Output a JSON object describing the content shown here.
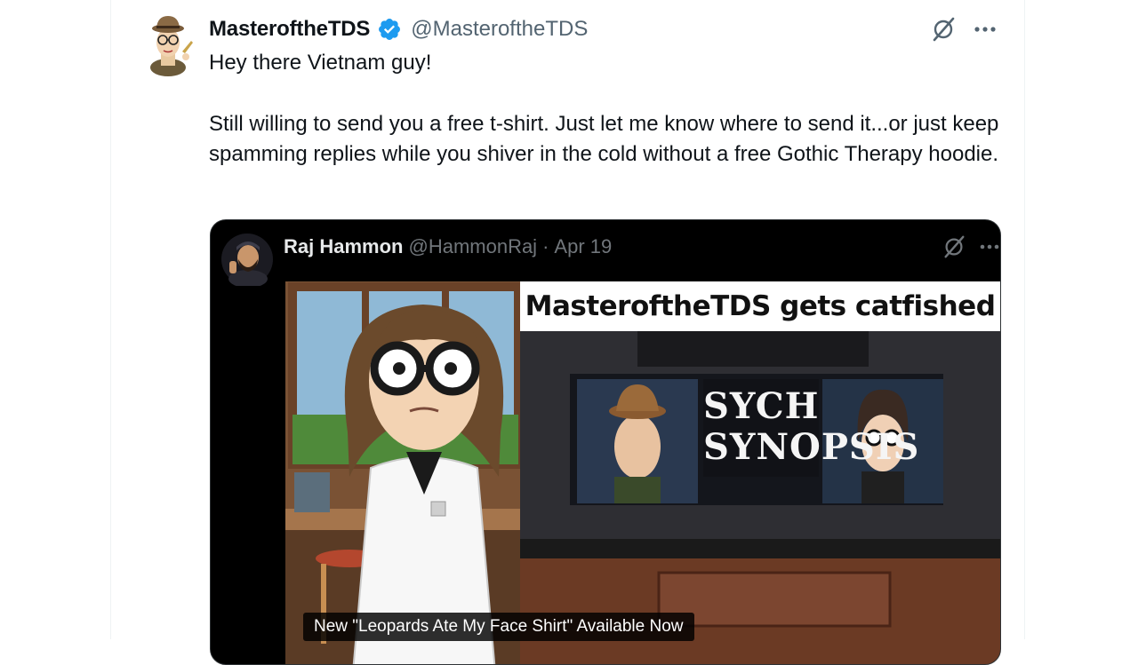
{
  "tweet": {
    "author_name": "MasteroftheTDS",
    "author_handle": "@MasteroftheTDS",
    "verified": true,
    "avatar_icon": "cartoon-man-with-hat-avatar",
    "actions": {
      "grok_icon": "grok-icon",
      "more_icon": "more-dots-icon"
    },
    "text_lines": [
      "Hey there Vietnam guy!",
      "Still willing to send you a free t-shirt. Just let me know where to send it...or just keep spamming replies while you shiver in the cold without a free Gothic Therapy hoodie."
    ]
  },
  "quoted_tweet": {
    "author_name": "Raj Hammon",
    "author_handle": "@HammonRaj",
    "separator": "·",
    "date": "Apr 19",
    "avatar_icon": "bearded-man-with-bandana-avatar",
    "actions": {
      "grok_icon": "grok-icon",
      "more_icon": "more-dots-icon"
    },
    "media": {
      "title_caption": "MasteroftheTDS gets catfished",
      "bottom_caption": "New \"Leopards Ate My Face Shirt\" Available Now",
      "logo_text": "SYCH SYNOPSIS"
    }
  },
  "colors": {
    "verified_blue": "#1d9bf0",
    "handle_gray": "#536471",
    "quote_bg": "#000000"
  }
}
